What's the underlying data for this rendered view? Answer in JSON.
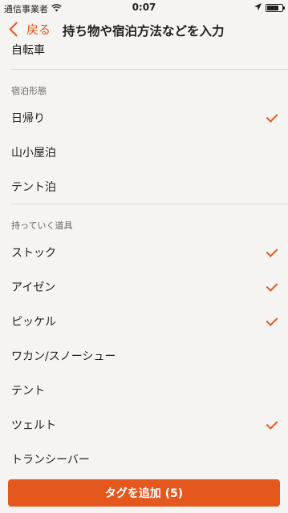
{
  "status": {
    "carrier": "通信事業者",
    "time": "0:07",
    "battery_level": 0.75
  },
  "nav": {
    "back_label": "戻る",
    "title": "持ち物や宿泊方法などを入力"
  },
  "top_item": {
    "label": "自転車"
  },
  "sections": [
    {
      "header": "宿泊形態",
      "items": [
        {
          "label": "日帰り",
          "checked": true
        },
        {
          "label": "山小屋泊",
          "checked": false
        },
        {
          "label": "テント泊",
          "checked": false
        }
      ]
    },
    {
      "header": "持っていく道具",
      "items": [
        {
          "label": "ストック",
          "checked": true
        },
        {
          "label": "アイゼン",
          "checked": true
        },
        {
          "label": "ピッケル",
          "checked": true
        },
        {
          "label": "ワカン/スノーシュー",
          "checked": false
        },
        {
          "label": "テント",
          "checked": false
        },
        {
          "label": "ツェルト",
          "checked": true
        },
        {
          "label": "トランシーバー",
          "checked": false
        }
      ]
    }
  ],
  "footer": {
    "add_button_label": "タグを追加 (5)"
  },
  "colors": {
    "accent": "#e4581e",
    "background": "#f5f4f2"
  },
  "icons": [
    "wifi-icon",
    "location-arrow-icon",
    "battery-icon",
    "chevron-left-icon",
    "checkmark-icon"
  ]
}
